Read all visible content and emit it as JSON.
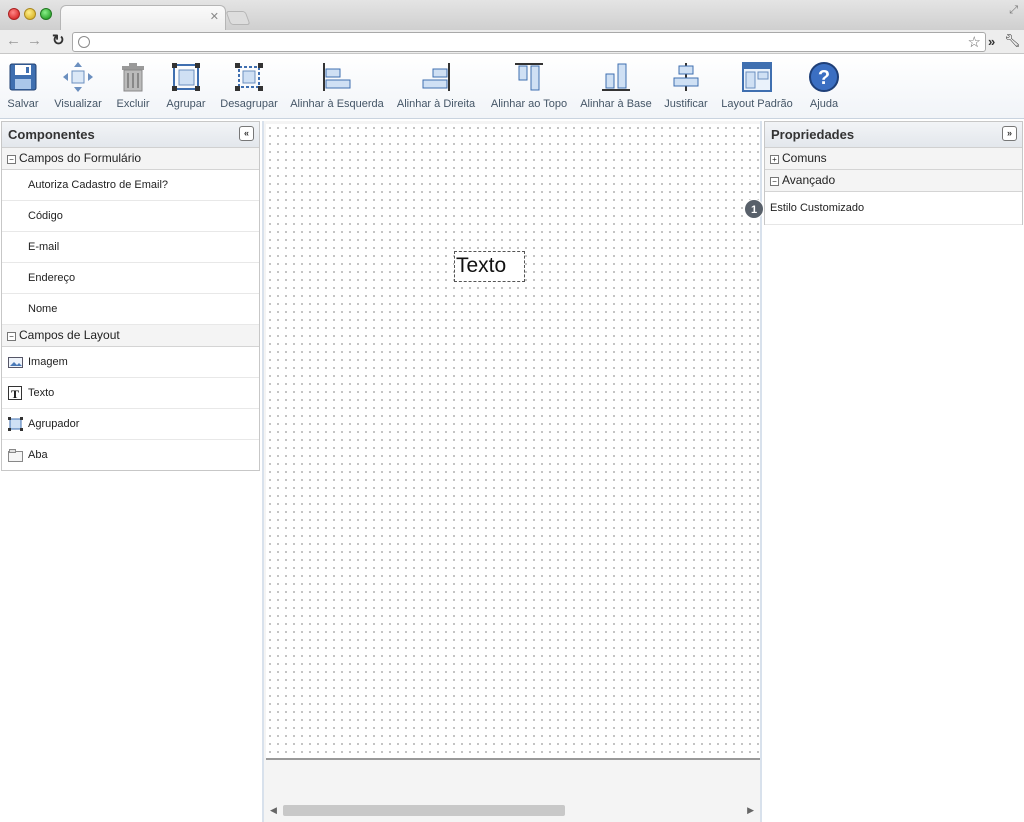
{
  "toolbar": {
    "buttons": [
      {
        "label": "Salvar",
        "icon": "save-icon"
      },
      {
        "label": "Visualizar",
        "icon": "move-icon"
      },
      {
        "label": "Excluir",
        "icon": "trash-icon"
      },
      {
        "label": "Agrupar",
        "icon": "group-icon"
      },
      {
        "label": "Desagrupar",
        "icon": "ungroup-icon"
      },
      {
        "label": "Alinhar à Esquerda",
        "icon": "align-left-icon"
      },
      {
        "label": "Alinhar à Direita",
        "icon": "align-right-icon"
      },
      {
        "label": "Alinhar ao Topo",
        "icon": "align-top-icon"
      },
      {
        "label": "Alinhar à Base",
        "icon": "align-bottom-icon"
      },
      {
        "label": "Justificar",
        "icon": "justify-icon"
      },
      {
        "label": "Layout Padrão",
        "icon": "layout-icon"
      },
      {
        "label": "Ajuda",
        "icon": "help-icon"
      }
    ]
  },
  "components": {
    "title": "Componentes",
    "collapse_glyph": "«",
    "form_group": {
      "label": "Campos do Formulário",
      "items": [
        "Autoriza Cadastro de Email?",
        "Código",
        "E-mail",
        "Endereço",
        "Nome"
      ]
    },
    "layout_group": {
      "label": "Campos de Layout",
      "items": [
        {
          "label": "Imagem",
          "icon": "image-icon"
        },
        {
          "label": "Texto",
          "icon": "text-icon"
        },
        {
          "label": "Agrupador",
          "icon": "group-icon"
        },
        {
          "label": "Aba",
          "icon": "tab-icon"
        }
      ]
    }
  },
  "properties": {
    "title": "Propriedades",
    "collapse_glyph": "»",
    "groups": [
      {
        "label": "Comuns",
        "state": "+"
      },
      {
        "label": "Avançado",
        "state": "−"
      }
    ],
    "row": "Estilo Customizado",
    "badge": "1"
  },
  "canvas": {
    "element_text": "Texto"
  },
  "colors": {
    "accent": "#3b78c2",
    "badge": "#58606a"
  }
}
